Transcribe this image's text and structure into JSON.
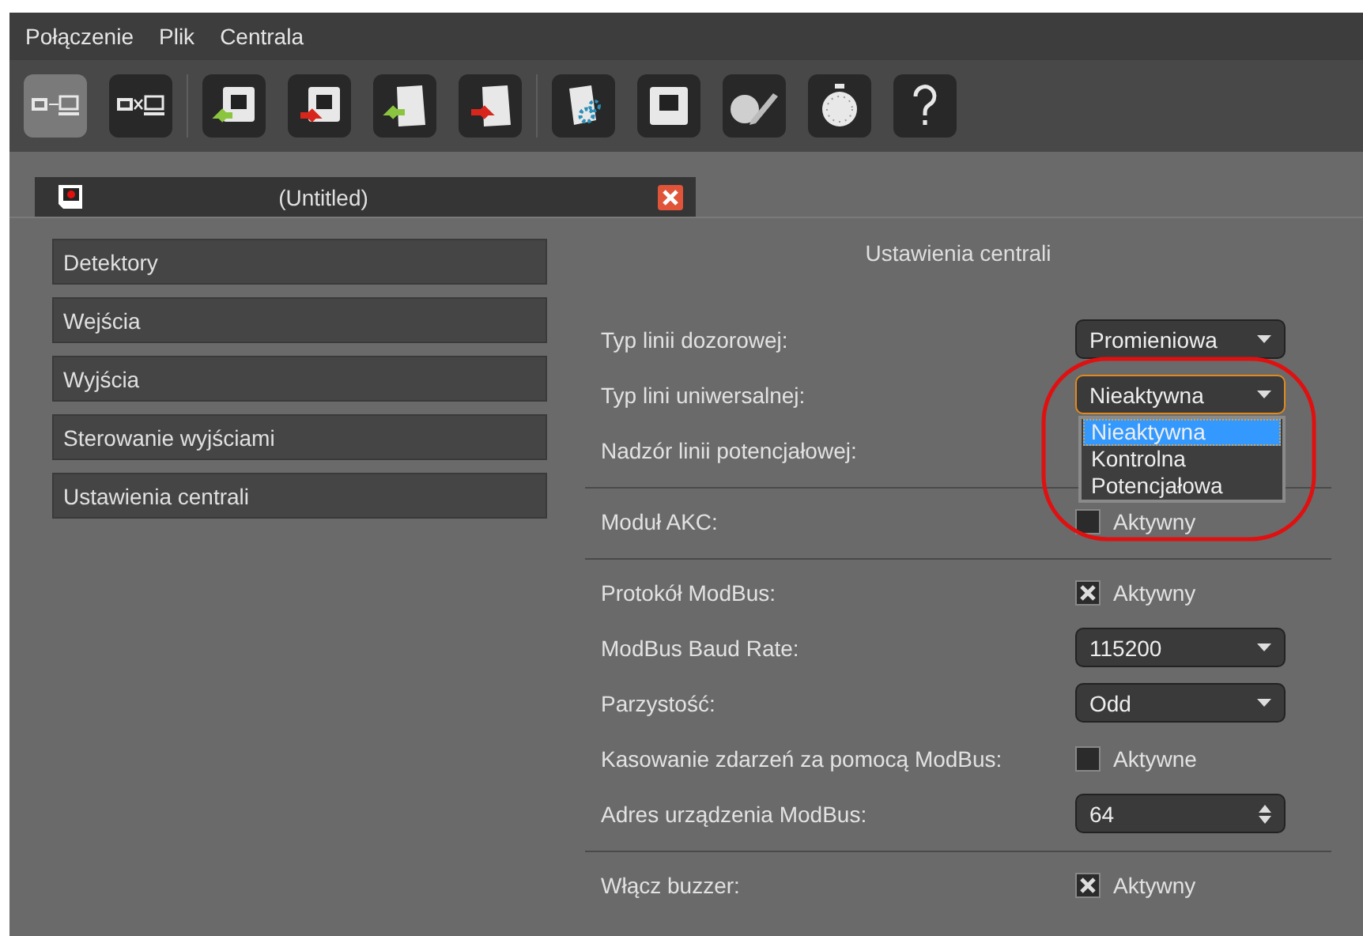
{
  "menu": [
    "Połączenie",
    "Plik",
    "Centrala"
  ],
  "toolbar": [
    [
      {
        "kind": "connect",
        "selected": true
      },
      {
        "kind": "disconnect",
        "selected": false
      }
    ],
    [
      {
        "kind": "read-device",
        "selected": false
      },
      {
        "kind": "write-device",
        "selected": false
      },
      {
        "kind": "open-file",
        "selected": false
      },
      {
        "kind": "save-file",
        "selected": false
      }
    ],
    [
      {
        "kind": "config",
        "selected": false
      },
      {
        "kind": "screen",
        "selected": false
      },
      {
        "kind": "pen",
        "selected": false
      },
      {
        "kind": "stopwatch",
        "selected": false
      },
      {
        "kind": "help",
        "selected": false
      }
    ]
  ],
  "tab": {
    "title": "(Untitled)"
  },
  "sidebar": {
    "items": [
      "Detektory",
      "Wejścia",
      "Wyjścia",
      "Sterowanie wyjściami",
      "Ustawienia centrali"
    ]
  },
  "panel": {
    "title": "Ustawienia centrali",
    "groups": [
      [
        {
          "label": "Typ linii dozorowej:",
          "kind": "select",
          "value": "Promieniowa",
          "open": false
        },
        {
          "label": "Typ lini uniwersalnej:",
          "kind": "select",
          "value": "Nieaktywna",
          "open": true,
          "options": [
            {
              "label": "Nieaktywna",
              "selected": true
            },
            {
              "label": "Kontrolna",
              "selected": false
            },
            {
              "label": "Potencjałowa",
              "selected": false
            }
          ]
        },
        {
          "label": "Nadzór linii potencjałowej:",
          "kind": "label"
        }
      ],
      [
        {
          "label": "Moduł AKC:",
          "kind": "checkbox",
          "text": "Aktywny",
          "checked": false
        }
      ],
      [
        {
          "label": "Protokół ModBus:",
          "kind": "checkbox",
          "text": "Aktywny",
          "checked": true
        },
        {
          "label": "ModBus Baud Rate:",
          "kind": "select",
          "value": "115200",
          "open": false
        },
        {
          "label": "Parzystość:",
          "kind": "select",
          "value": "Odd",
          "open": false
        },
        {
          "label": "Kasowanie zdarzeń za pomocą ModBus:",
          "kind": "checkbox",
          "text": "Aktywne",
          "checked": false
        },
        {
          "label": "Adres urządzenia ModBus:",
          "kind": "spin",
          "value": "64"
        }
      ],
      [
        {
          "label": "Włącz buzzer:",
          "kind": "checkbox",
          "text": "Aktywny",
          "checked": true
        }
      ]
    ]
  }
}
